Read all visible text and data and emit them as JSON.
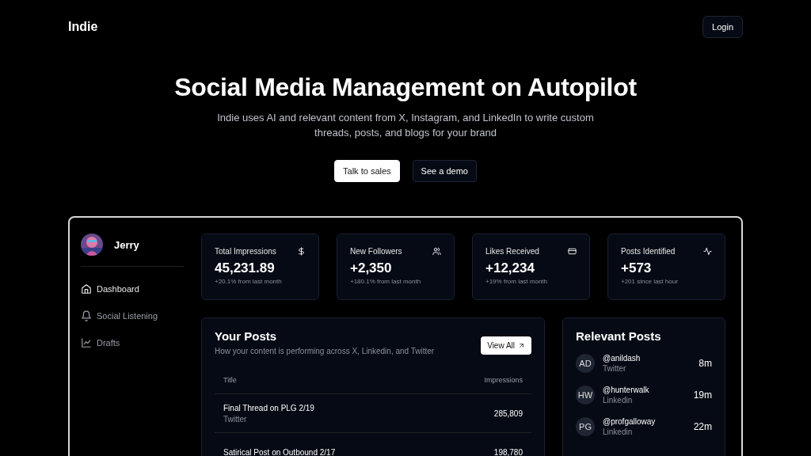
{
  "brand": "Indie",
  "login": "Login",
  "hero": {
    "title": "Social Media Management on Autopilot",
    "subtitle": "Indie uses AI and relevant content from X, Instagram, and LinkedIn to write custom threads, posts, and blogs for your brand",
    "buttons": [
      {
        "label": "Talk to sales",
        "kind": "primary"
      },
      {
        "label": "See a demo",
        "kind": "secondary"
      }
    ]
  },
  "sidebar": {
    "user": "Jerry",
    "items": [
      {
        "label": "Dashboard",
        "selected": true
      },
      {
        "label": "Social Listening",
        "selected": false
      },
      {
        "label": "Drafts",
        "selected": false
      }
    ]
  },
  "stats": [
    {
      "title": "Total Impressions",
      "value": "45,231.89",
      "note": "+20.1% from last month"
    },
    {
      "title": "New Followers",
      "value": "+2,350",
      "note": "+180.1% from last month"
    },
    {
      "title": "Likes Received",
      "value": "+12,234",
      "note": "+19% from last month"
    },
    {
      "title": "Posts Identified",
      "value": "+573",
      "note": "+201 since last hour"
    }
  ],
  "your_posts": {
    "title": "Your Posts",
    "subtitle": "How your content is performing across X, Linkedin, and Twitter",
    "button": "View All",
    "columns": [
      "Title",
      "Impressions"
    ],
    "rows": [
      {
        "title": "Final Thread on PLG 2/19",
        "platform": "Twitter",
        "impressions": "285,809"
      },
      {
        "title": "Satirical Post on Outbound 2/17",
        "impressions": "198,780"
      }
    ]
  },
  "relevant_posts": {
    "title": "Relevant Posts",
    "items": [
      {
        "initials": "AD",
        "handle": "@anildash",
        "platform": "Twitter",
        "time": "8m"
      },
      {
        "initials": "HW",
        "handle": "@hunterwalk",
        "platform": "Linkedin",
        "time": "19m"
      },
      {
        "initials": "PG",
        "handle": "@profgalloway",
        "platform": "Linkedin",
        "time": "22m"
      }
    ]
  }
}
